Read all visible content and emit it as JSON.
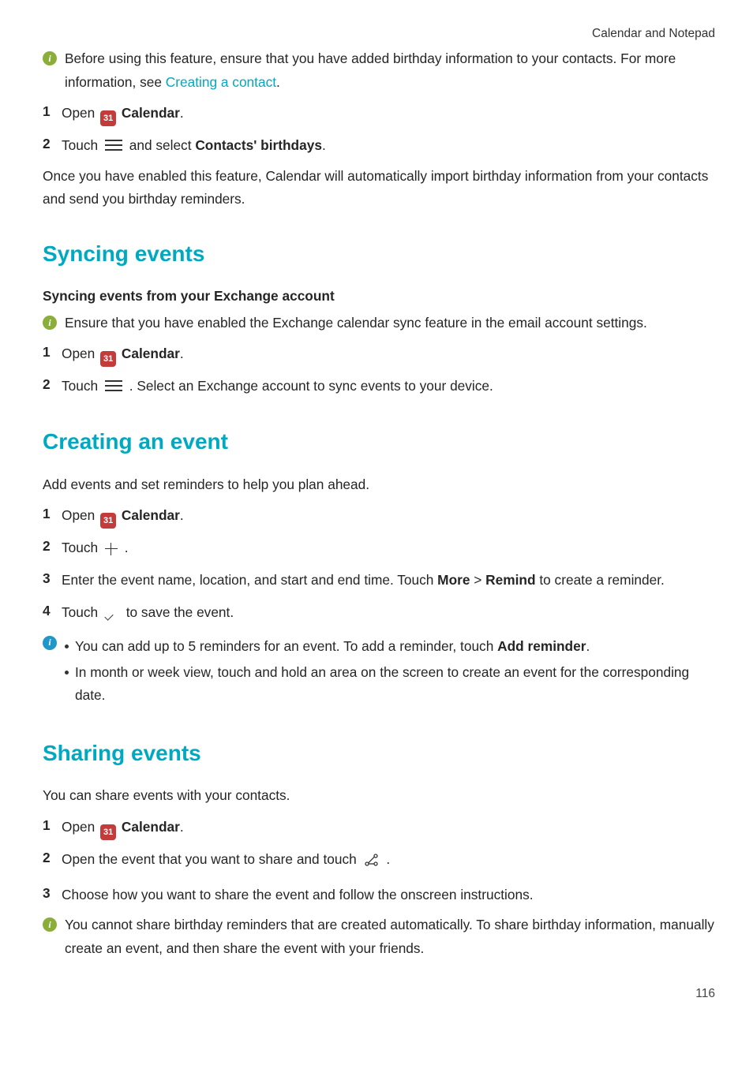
{
  "header": {
    "section": "Calendar and Notepad"
  },
  "intro_info": {
    "part1": "Before using this feature, ensure that you have added birthday information to your contacts. For more information, see ",
    "link": "Creating a contact",
    "part2": "."
  },
  "intro_steps": {
    "s1_a": "Open ",
    "s1_b": "Calendar",
    "s1_c": ".",
    "s2_a": "Touch ",
    "s2_b": " and select ",
    "s2_c": "Contacts' birthdays",
    "s2_d": "."
  },
  "intro_para": "Once you have enabled this feature, Calendar will automatically import birthday information from your contacts and send you birthday reminders.",
  "syncing": {
    "title": "Syncing events",
    "subtitle": "Syncing events from your Exchange account",
    "info": "Ensure that you have enabled the Exchange calendar sync feature in the email account settings.",
    "s1_a": "Open ",
    "s1_b": "Calendar",
    "s1_c": ".",
    "s2_a": "Touch ",
    "s2_b": " . Select an Exchange account to sync events to your device."
  },
  "creating": {
    "title": "Creating an event",
    "lead": "Add events and set reminders to help you plan ahead.",
    "s1_a": "Open ",
    "s1_b": "Calendar",
    "s1_c": ".",
    "s2_a": "Touch ",
    "s2_b": " .",
    "s3_a": "Enter the event name, location, and start and end time. Touch ",
    "s3_b": "More",
    "s3_gt": " > ",
    "s3_c": "Remind",
    "s3_d": " to create a reminder.",
    "s4_a": "Touch ",
    "s4_b": " to save the event.",
    "b1_a": "You can add up to 5 reminders for an event. To add a reminder, touch ",
    "b1_b": "Add reminder",
    "b1_c": ".",
    "b2": "In month or week view, touch and hold an area on the screen to create an event for the corresponding date."
  },
  "sharing": {
    "title": "Sharing events",
    "lead": "You can share events with your contacts.",
    "s1_a": "Open ",
    "s1_b": "Calendar",
    "s1_c": ".",
    "s2_a": "Open the event that you want to share and touch ",
    "s2_b": " .",
    "s3": "Choose how you want to share the event and follow the onscreen instructions.",
    "info": "You cannot share birthday reminders that are created automatically. To share birthday information, manually create an event, and then share the event with your friends."
  },
  "cal_badge": "31",
  "page_number": "116"
}
